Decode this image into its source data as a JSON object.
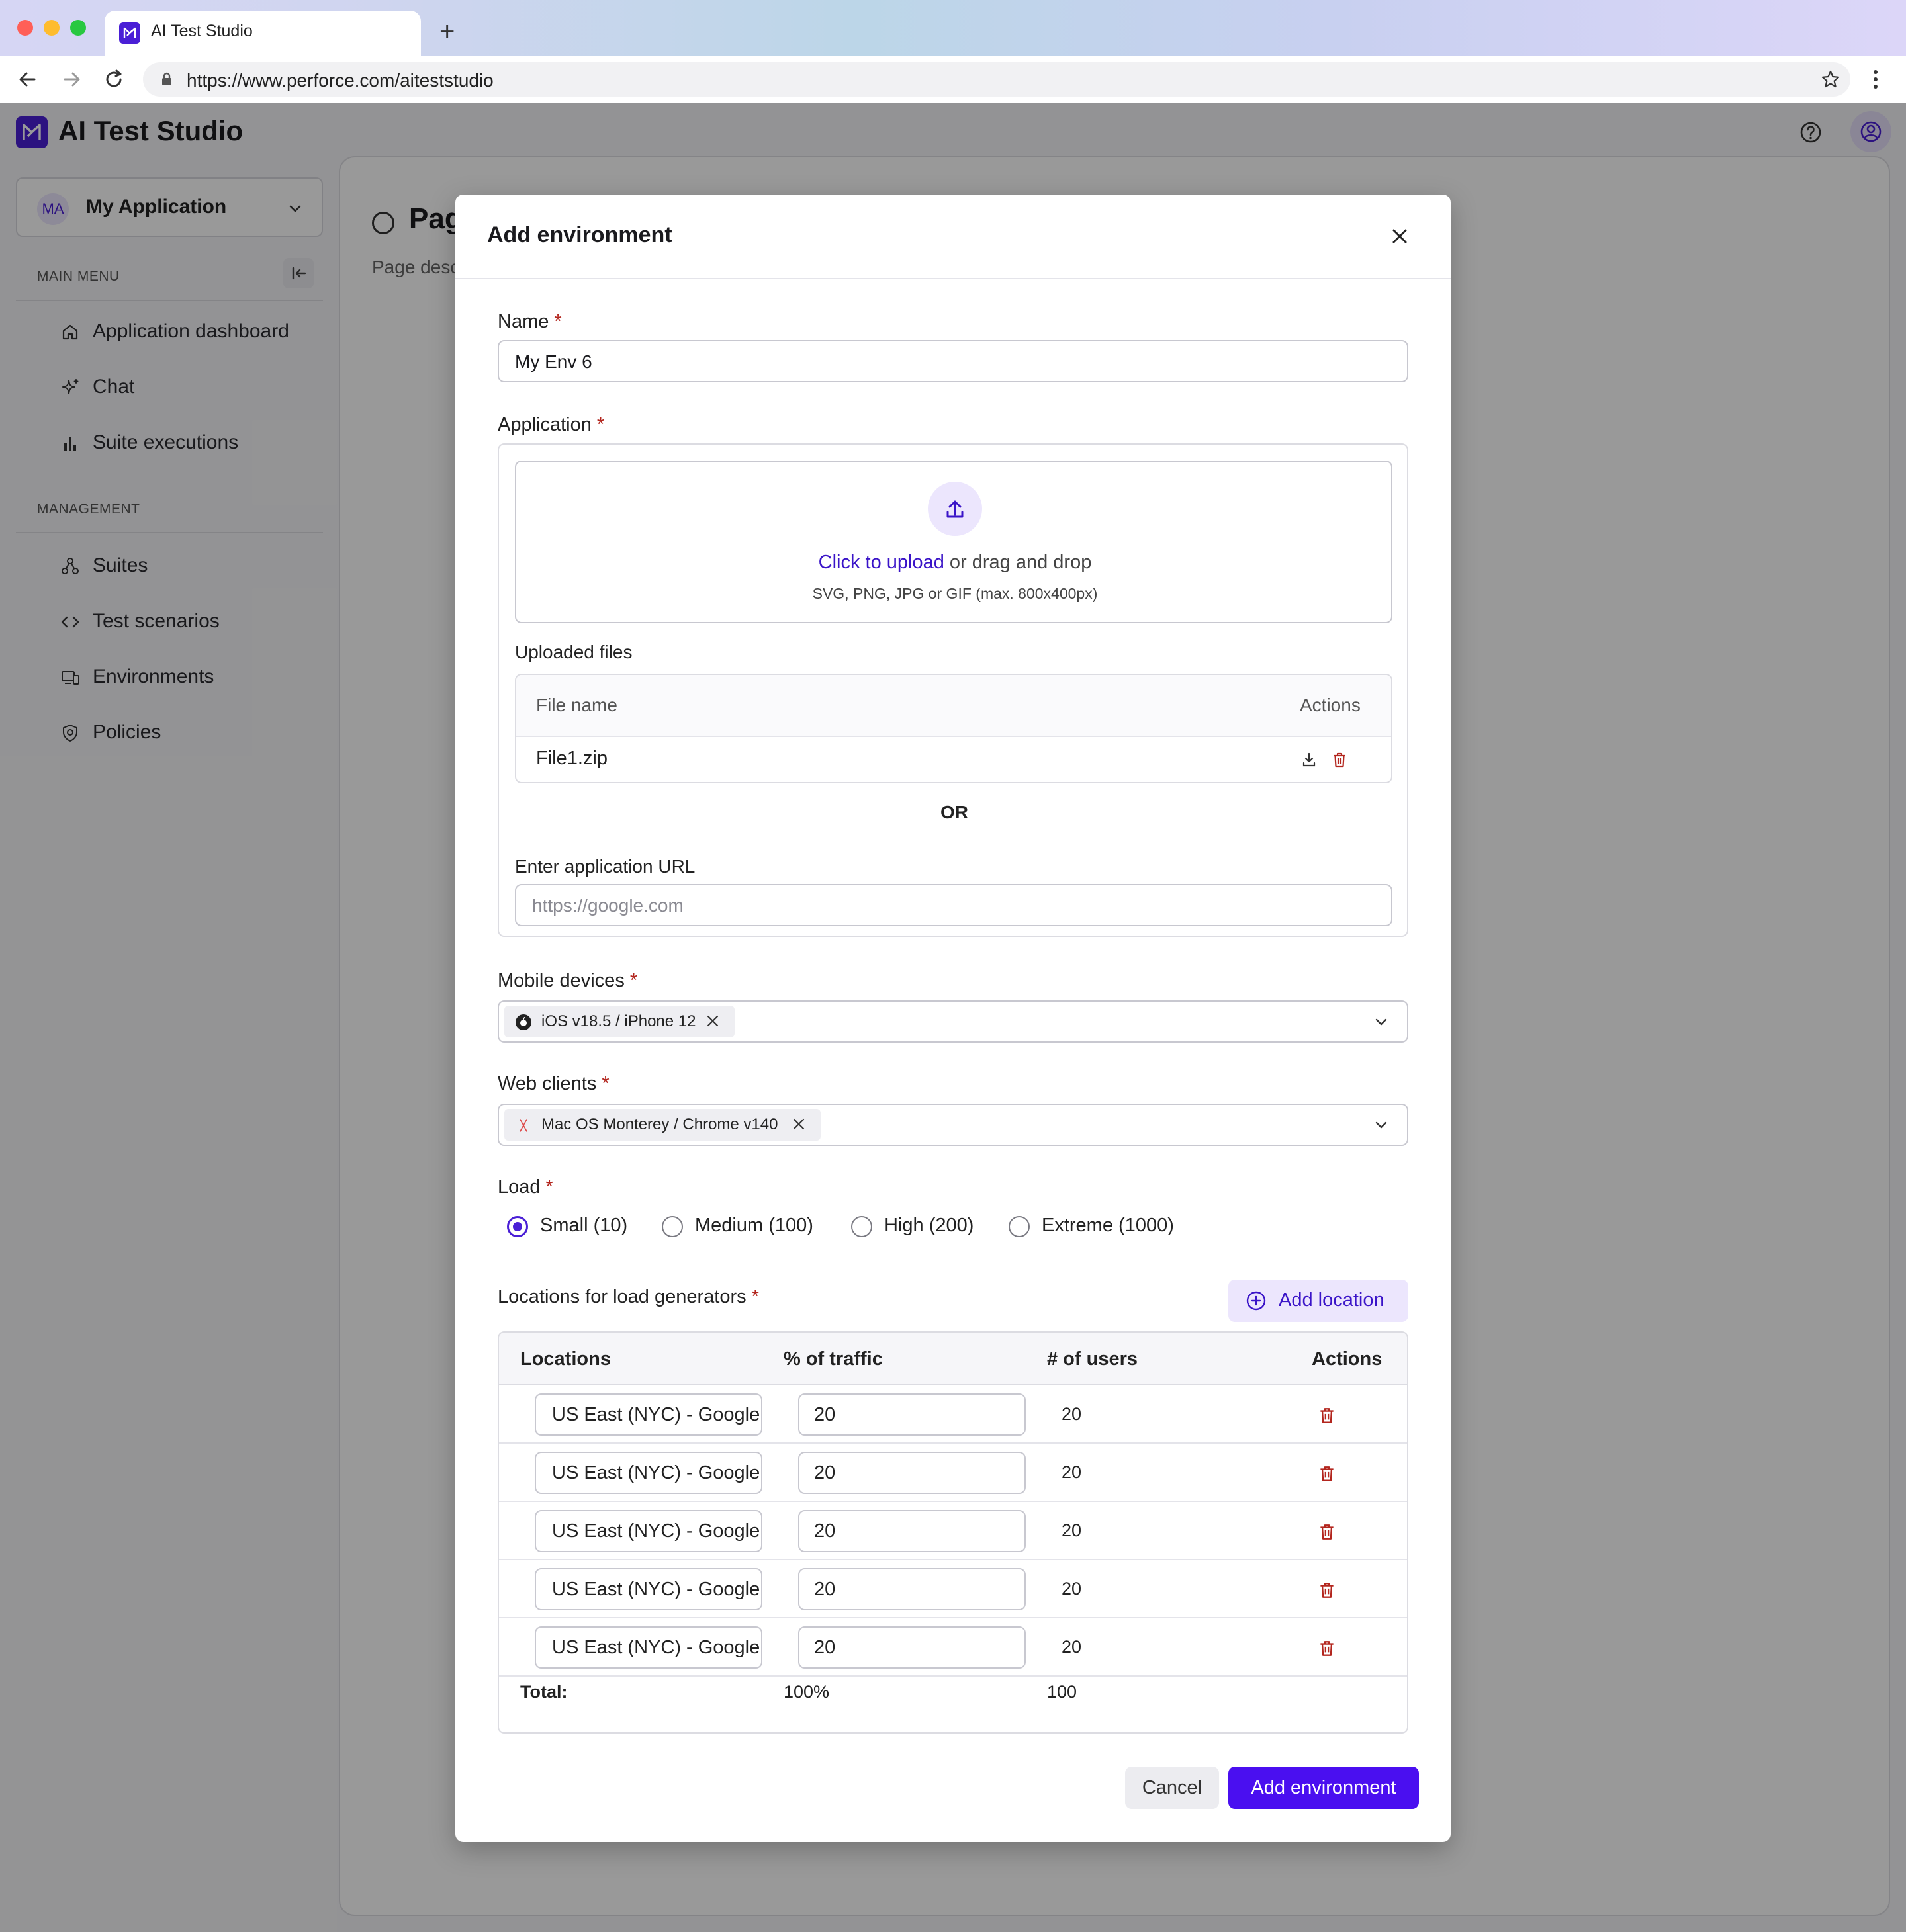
{
  "browser": {
    "tab_title": "AI Test Studio",
    "new_tab": "+",
    "url": "https://www.perforce.com/aiteststudio"
  },
  "app": {
    "title": "AI Test Studio",
    "brand_color": "#4a1fd6"
  },
  "sidebar": {
    "app_avatar": "MA",
    "app_name": "My Application",
    "main_menu_label": "MAIN MENU",
    "main_items": [
      {
        "label": "Application dashboard",
        "icon": "home-icon"
      },
      {
        "label": "Chat",
        "icon": "sparkle-icon"
      },
      {
        "label": "Suite executions",
        "icon": "bar-chart-icon"
      }
    ],
    "management_label": "MANAGEMENT",
    "management_items": [
      {
        "label": "Suites",
        "icon": "suites-icon"
      },
      {
        "label": "Test scenarios",
        "icon": "code-icon"
      },
      {
        "label": "Environments",
        "icon": "devices-icon"
      },
      {
        "label": "Policies",
        "icon": "shield-icon"
      }
    ]
  },
  "page": {
    "title": "Pag",
    "description": "Page desc"
  },
  "modal": {
    "title": "Add environment",
    "name_label": "Name",
    "required_mark": "*",
    "name_value": "My Env 6",
    "application_label": "Application",
    "upload_link": "Click to upload",
    "upload_text": " or drag and drop",
    "upload_hint": "SVG, PNG, JPG or GIF (max. 800x400px)",
    "uploaded_files_label": "Uploaded files",
    "files_columns": [
      "File name",
      "Actions"
    ],
    "files": [
      {
        "name": "File1.zip"
      }
    ],
    "or_label": "OR",
    "url_label": "Enter application URL",
    "url_placeholder": "https://google.com",
    "mobile_label": "Mobile devices",
    "mobile_chip": "iOS v18.5 / iPhone 12",
    "web_label": "Web clients",
    "web_chip": "Mac OS Monterey / Chrome v140",
    "load_label": "Load",
    "load_options": [
      {
        "label": "Small (10)",
        "selected": true
      },
      {
        "label": "Medium (100)",
        "selected": false
      },
      {
        "label": "High (200)",
        "selected": false
      },
      {
        "label": "Extreme (1000)",
        "selected": false
      }
    ],
    "locations_label": "Locations  for load generators",
    "add_location": "Add location",
    "locations_columns": [
      "Locations",
      "% of traffic",
      "# of users",
      "Actions"
    ],
    "locations": [
      {
        "location": "US East (NYC) - Google Cloud",
        "traffic": "20",
        "users": "20"
      },
      {
        "location": "US East (NYC) - Google Cloud",
        "traffic": "20",
        "users": "20"
      },
      {
        "location": "US East (NYC) - Google Cloud",
        "traffic": "20",
        "users": "20"
      },
      {
        "location": "US East (NYC) - Google Cloud",
        "traffic": "20",
        "users": "20"
      },
      {
        "location": "US East (NYC) - Google Cloud",
        "traffic": "20",
        "users": "20"
      }
    ],
    "total_label": "Total:",
    "total_traffic": "100%",
    "total_users": "100",
    "cancel": "Cancel",
    "submit": "Add environment",
    "delete_color": "#b3261e"
  }
}
